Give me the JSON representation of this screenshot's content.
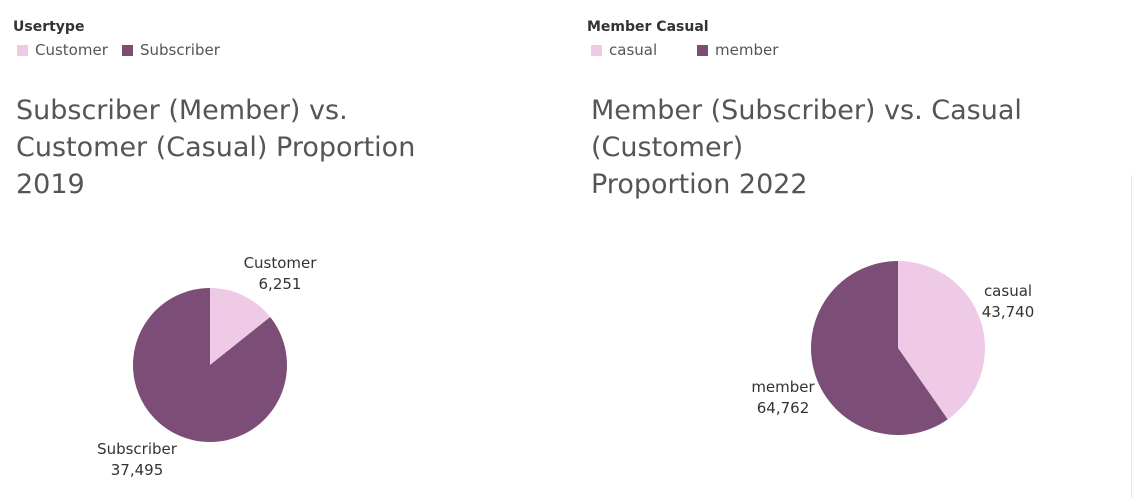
{
  "colors": {
    "light": "#eecae6",
    "dark": "#7b4d77"
  },
  "chart_data": [
    {
      "type": "pie",
      "legend_title": "Usertype",
      "title": "Subscriber (Member) vs. Customer (Casual) Proportion 2019",
      "title_lines": [
        "Subscriber (Member) vs.",
        "Customer (Casual) Proportion",
        "2019"
      ],
      "legend": [
        "Customer",
        "Subscriber"
      ],
      "slices": [
        {
          "label": "Customer",
          "value": 6251,
          "value_label": "6,251",
          "color": "#eecae6"
        },
        {
          "label": "Subscriber",
          "value": 37495,
          "value_label": "37,495",
          "color": "#7b4d77"
        }
      ]
    },
    {
      "type": "pie",
      "legend_title": "Member Casual",
      "title": "Member (Subscriber) vs. Casual (Customer) Proportion 2022",
      "title_lines": [
        "Member (Subscriber) vs. Casual (Customer)",
        "Proportion 2022"
      ],
      "legend": [
        "casual",
        "member"
      ],
      "slices": [
        {
          "label": "casual",
          "value": 43740,
          "value_label": "43,740",
          "color": "#eecae6"
        },
        {
          "label": "member",
          "value": 64762,
          "value_label": "64,762",
          "color": "#7b4d77"
        }
      ]
    }
  ]
}
